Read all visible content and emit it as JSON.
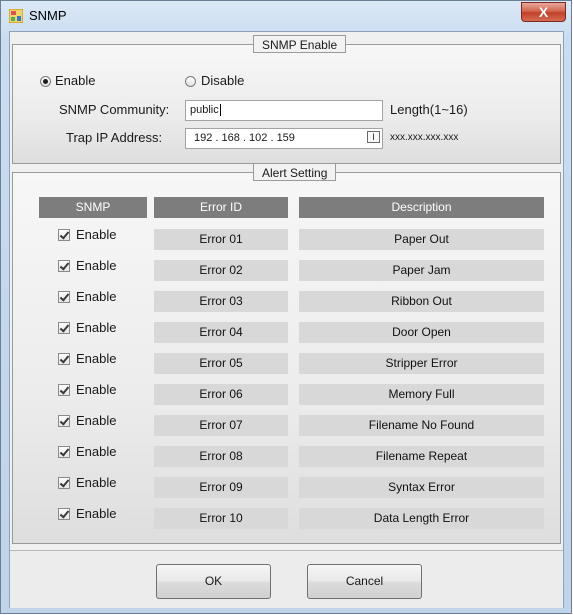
{
  "window": {
    "title": "SNMP",
    "close_symbol": "X"
  },
  "snmp_enable": {
    "legend": "SNMP Enable",
    "enable_label": "Enable",
    "disable_label": "Disable",
    "selected": "Enable",
    "community_label": "SNMP Community:",
    "community_value": "public",
    "community_hint": "Length(1~16)",
    "trap_label": "Trap IP Address:",
    "trap_ip": "192 . 168 . 102 . 159",
    "trap_format": "xxx.xxx.xxx.xxx"
  },
  "alert": {
    "legend": "Alert Setting",
    "headers": {
      "snmp": "SNMP",
      "error_id": "Error ID",
      "description": "Description"
    },
    "enable_label": "Enable",
    "rows": [
      {
        "checked": true,
        "error_id": "Error 01",
        "description": "Paper Out"
      },
      {
        "checked": true,
        "error_id": "Error 02",
        "description": "Paper Jam"
      },
      {
        "checked": true,
        "error_id": "Error 03",
        "description": "Ribbon Out"
      },
      {
        "checked": true,
        "error_id": "Error 04",
        "description": "Door Open"
      },
      {
        "checked": true,
        "error_id": "Error 05",
        "description": "Stripper Error"
      },
      {
        "checked": true,
        "error_id": "Error 06",
        "description": "Memory Full"
      },
      {
        "checked": true,
        "error_id": "Error 07",
        "description": "Filename No Found"
      },
      {
        "checked": true,
        "error_id": "Error 08",
        "description": "Filename Repeat"
      },
      {
        "checked": true,
        "error_id": "Error 09",
        "description": "Syntax Error"
      },
      {
        "checked": true,
        "error_id": "Error 10",
        "description": "Data Length Error"
      }
    ]
  },
  "buttons": {
    "ok": "OK",
    "cancel": "Cancel"
  }
}
